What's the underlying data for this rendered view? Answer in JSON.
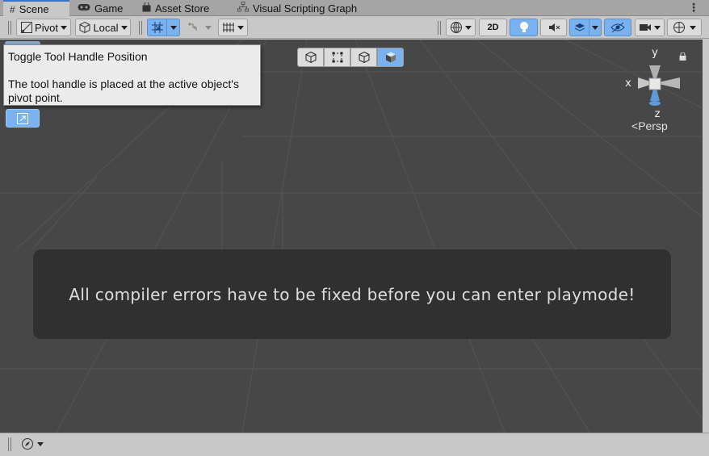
{
  "tabs": [
    {
      "label": "Scene",
      "icon": "grid-icon",
      "active": true
    },
    {
      "label": "Game",
      "icon": "gamepad-icon",
      "active": false
    },
    {
      "label": "Asset Store",
      "icon": "store-bag-icon",
      "active": false
    },
    {
      "label": "Visual Scripting Graph",
      "icon": "graph-icon",
      "active": false
    }
  ],
  "toolbar": {
    "pivot_label": "Pivot",
    "local_label": "Local",
    "mode_2d_label": "2D"
  },
  "tooltip": {
    "title": "Toggle Tool Handle Position",
    "body": "The tool handle is placed at the active object's pivot point."
  },
  "gizmo": {
    "y_label": "y",
    "x_label": "x",
    "z_label": "z",
    "projection_label": "Persp"
  },
  "banner": {
    "message": "All compiler errors have to be fixed before you can enter playmode!"
  },
  "colors": {
    "accent_blue": "#7ab2f0",
    "viewport_bg": "#474747",
    "toolbar_bg": "#c8c8c8"
  }
}
